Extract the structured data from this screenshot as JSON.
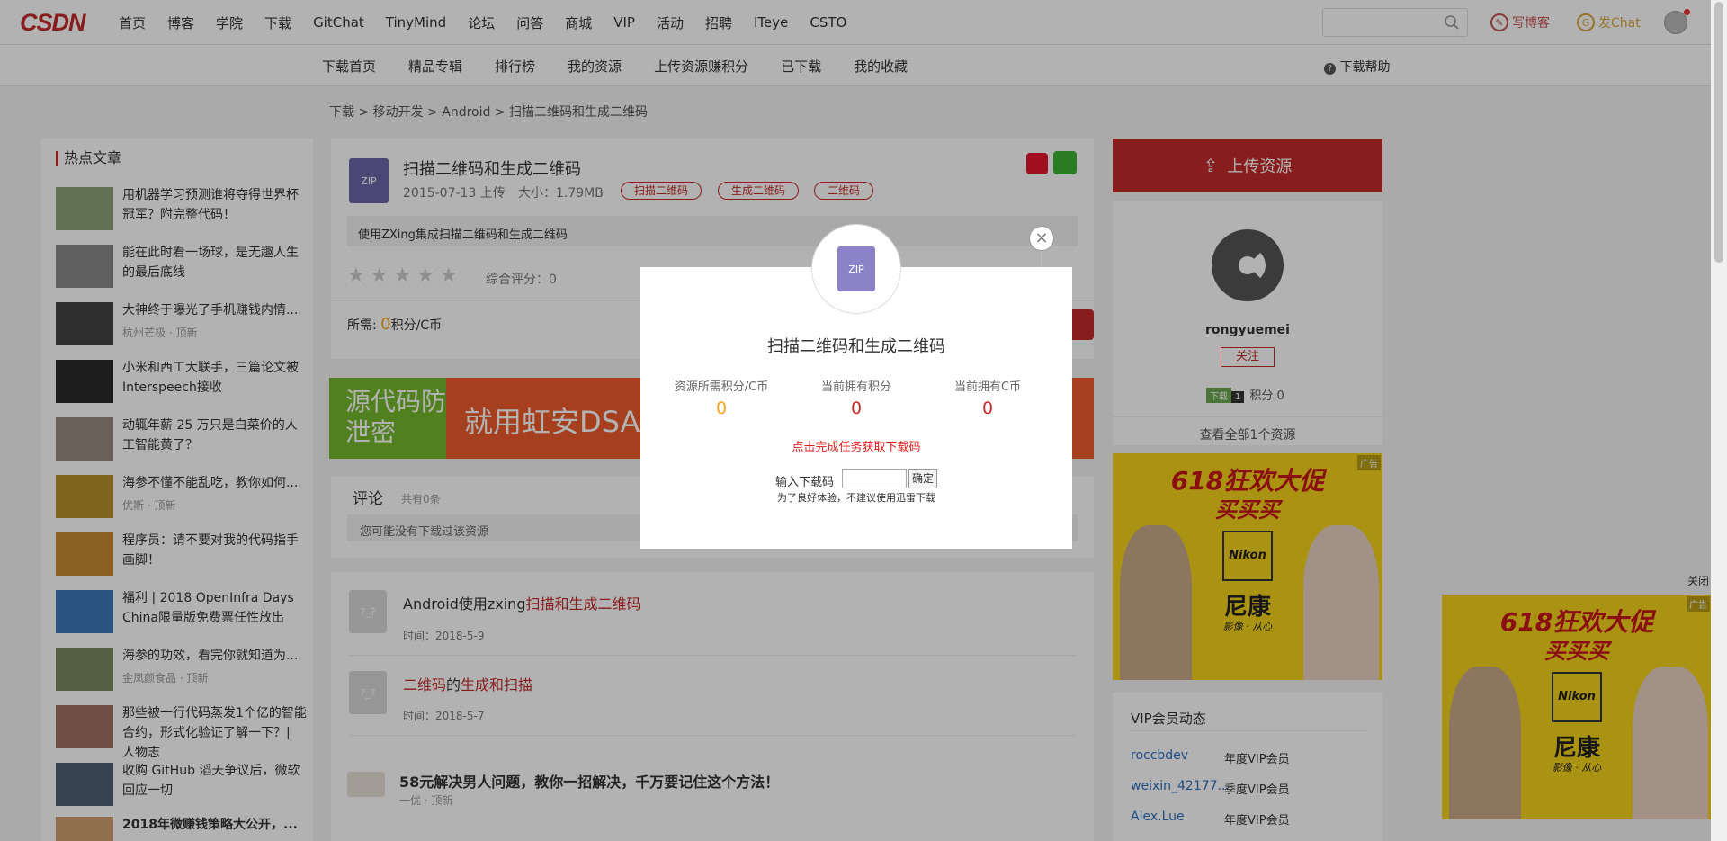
{
  "topnav": {
    "logo": "CSDN",
    "items": [
      "首页",
      "博客",
      "学院",
      "下载",
      "GitChat",
      "TinyMind",
      "论坛",
      "问答",
      "商城",
      "VIP",
      "活动",
      "招聘",
      "ITeye",
      "CSTO"
    ],
    "write_blog": "写博客",
    "fachat": "发Chat"
  },
  "subnav": {
    "items": [
      "下载首页",
      "精品专辑",
      "排行榜",
      "我的资源",
      "上传资源赚积分",
      "已下载",
      "我的收藏"
    ],
    "help": "下载帮助"
  },
  "breadcrumb": "下载 >  移动开发 >  Android > 扫描二维码和生成二维码",
  "hot": {
    "title": "热点文章",
    "articles": [
      {
        "title": "用机器学习预测谁将夺得世界杯冠军？附完整代码！",
        "meta": ""
      },
      {
        "title": "能在此时看一场球，是无趣人生的最后底线",
        "meta": ""
      },
      {
        "title": "大神终于曝光了手机赚钱内情...",
        "meta": "杭州芒极 · 顶新"
      },
      {
        "title": "小米和西工大联手，三篇论文被Interspeech接收",
        "meta": ""
      },
      {
        "title": "动辄年薪 25 万只是白菜价的人工智能黄了？",
        "meta": ""
      },
      {
        "title": "海参不懂不能乱吃，教你如何...",
        "meta": "优斯 · 顶新"
      },
      {
        "title": "程序员：请不要对我的代码指手画脚！",
        "meta": ""
      },
      {
        "title": "福利 | 2018 OpenInfra Days China限量版免费票任性放出",
        "meta": ""
      },
      {
        "title": "海参的功效，看完你就知道为...",
        "meta": "金凤颜食品 · 顶新"
      },
      {
        "title": "那些被一行代码蒸发1个亿的智能合约，形式化验证了解一下？| 人物志",
        "meta": ""
      },
      {
        "title": "收购 GitHub 滔天争议后，微软回应一切",
        "meta": ""
      },
      {
        "title": "2018年微赚钱策略大公开，...",
        "meta": ""
      }
    ]
  },
  "resource": {
    "icon_text": "ZIP",
    "title": "扫描二维码和生成二维码",
    "date": "2015-07-13 上传",
    "size": "大小：1.79MB",
    "tags": [
      "扫描二维码",
      "生成二维码",
      "二维码"
    ],
    "description": "使用ZXing集成扫描二维码和生成二维码",
    "stars": "★★★★★",
    "rating": "综合评分：0",
    "need_label": "所需:",
    "need_value": "0",
    "need_unit": "积分/C币"
  },
  "dsa_ad": {
    "left": "源代码防泄密",
    "text": "就用虹安DSA数"
  },
  "comments": {
    "title": "评论",
    "count": "共有0条",
    "placeholder": "您可能没有下载过该资源"
  },
  "related": [
    {
      "icon": "?_?",
      "title_plain": "Android使用zxing",
      "title_hl": "扫描和生成二维码",
      "time": "时间：2018-5-9"
    },
    {
      "icon": "?_?",
      "title_hl_a": "二维码",
      "title_mid": "的",
      "title_hl_b": "生成和扫描",
      "time": "时间：2018-5-7"
    }
  ],
  "related_ad": {
    "title": "58元解决男人问题，教你一招解决，千万要记住这个方法！",
    "meta": "一优 · 顶新"
  },
  "right": {
    "upload": "上传资源",
    "username": "rongyuemei",
    "follow": "关注",
    "level_label": "下载",
    "level_num": "1",
    "points": "积分 0",
    "view_all": "查看全部1个资源"
  },
  "nikon_ad": {
    "title_line1": "618狂欢大促",
    "title_line2": "买买买",
    "brand_en": "Nikon",
    "brand_cn": "尼康",
    "slogan": "影像 · 从心",
    "badge": "广告",
    "close": "关闭"
  },
  "vip": {
    "title": "VIP会员动态",
    "rows": [
      {
        "user": "roccbdev",
        "type": "年度VIP会员"
      },
      {
        "user": "weixin_42177...",
        "type": "季度VIP会员"
      },
      {
        "user": "Alex.Lue",
        "type": "年度VIP会员"
      }
    ]
  },
  "modal": {
    "icon_text": "ZIP",
    "title": "扫描二维码和生成二维码",
    "labels": [
      "资源所需积分/C币",
      "当前拥有积分",
      "当前拥有C币"
    ],
    "values": [
      "0",
      "0",
      "0"
    ],
    "task_link": "点击完成任务获取下载码",
    "code_label": "输入下载码",
    "ok": "确定",
    "note": "为了良好体验，不建议使用迅雷下载",
    "close": "×"
  },
  "colors": {
    "brand": "#c32a2a",
    "accent_orange": "#f5a623",
    "nikon_yellow": "#f4d11c"
  }
}
